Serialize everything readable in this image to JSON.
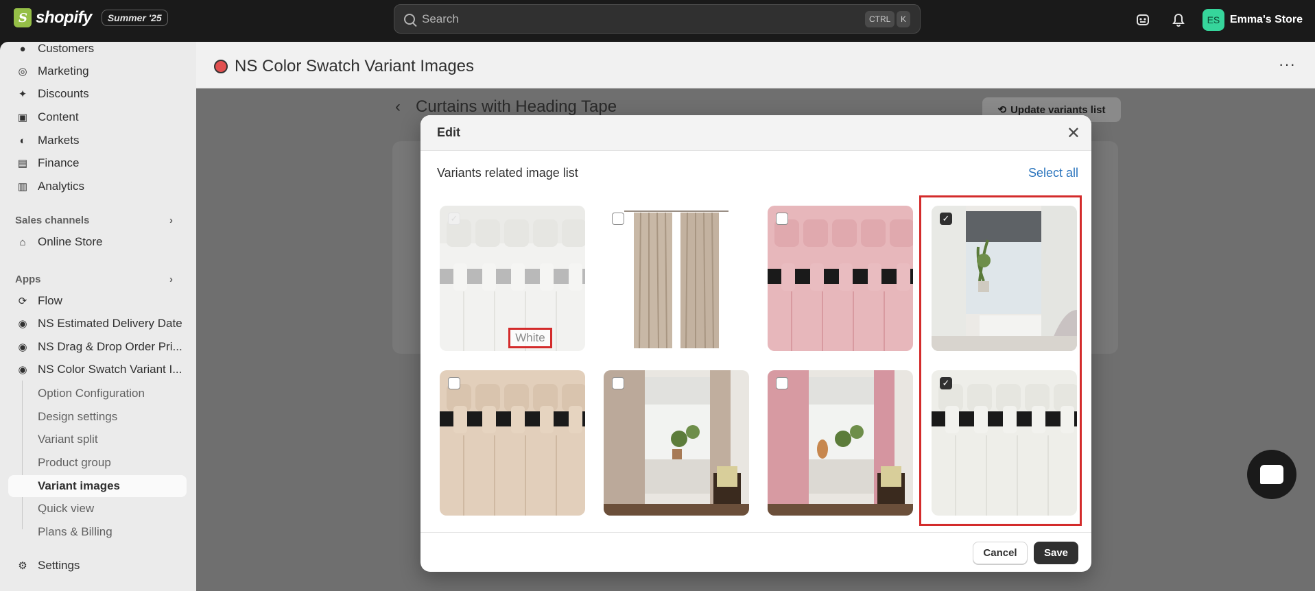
{
  "topbar": {
    "brand": "shopify",
    "badge": "Summer '25",
    "search_placeholder": "Search",
    "shortcut_ctrl": "CTRL",
    "shortcut_key": "K",
    "store_initials": "ES",
    "store_name": "Emma's Store"
  },
  "sidebar": {
    "items": [
      {
        "label": "Customers",
        "icon": "person-icon"
      },
      {
        "label": "Marketing",
        "icon": "target-icon"
      },
      {
        "label": "Discounts",
        "icon": "discount-icon"
      },
      {
        "label": "Content",
        "icon": "content-icon"
      },
      {
        "label": "Markets",
        "icon": "globe-icon"
      },
      {
        "label": "Finance",
        "icon": "bank-icon"
      },
      {
        "label": "Analytics",
        "icon": "chart-icon"
      }
    ],
    "sales_channels_heading": "Sales channels",
    "online_store": "Online Store",
    "apps_heading": "Apps",
    "apps": [
      "Flow",
      "NS Estimated Delivery Date",
      "NS Drag & Drop Order Pri...",
      "NS Color Swatch Variant I..."
    ],
    "subitems": [
      "Option Configuration",
      "Design settings",
      "Variant split",
      "Product group",
      "Variant images",
      "Quick view",
      "Plans & Billing"
    ],
    "settings": "Settings"
  },
  "app_header": {
    "title": "NS Color Swatch Variant Images"
  },
  "background_page": {
    "title": "Curtains with Heading Tape",
    "update_button": "Update variants list"
  },
  "modal": {
    "title": "Edit",
    "list_label": "Variants related image list",
    "select_all": "Select all",
    "white_label": "White",
    "cancel": "Cancel",
    "save": "Save",
    "tiles": [
      {
        "name": "white-curtain-rod",
        "checked": false,
        "disabled": true
      },
      {
        "name": "beige-curtain-pair",
        "checked": false,
        "disabled": false
      },
      {
        "name": "pink-curtain-rod",
        "checked": false,
        "disabled": false
      },
      {
        "name": "white-curtain-room",
        "checked": true,
        "disabled": false
      },
      {
        "name": "beige-curtain-rod",
        "checked": false,
        "disabled": false
      },
      {
        "name": "beige-curtain-room",
        "checked": false,
        "disabled": false
      },
      {
        "name": "pink-curtain-room",
        "checked": false,
        "disabled": false
      },
      {
        "name": "white-curtain-rod-2",
        "checked": true,
        "disabled": false
      }
    ]
  }
}
